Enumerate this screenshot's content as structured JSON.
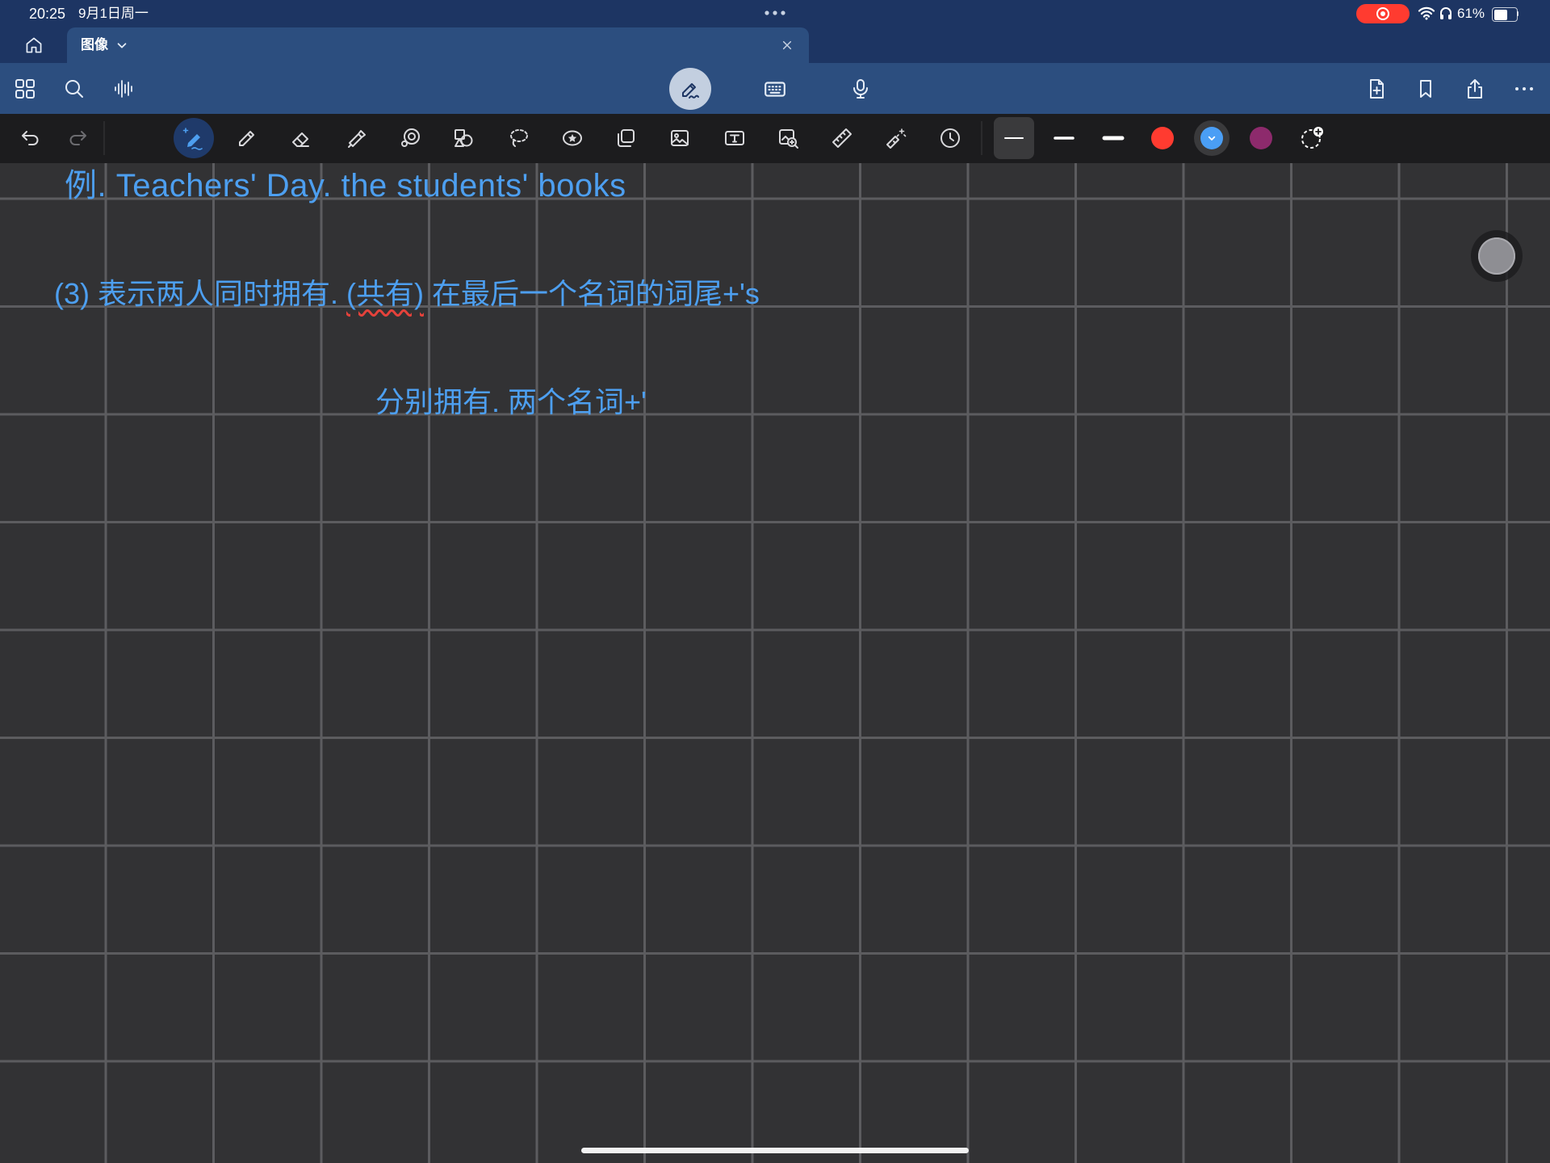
{
  "status_bar": {
    "time": "20:25",
    "date": "9月1日周一",
    "battery_text": "61%",
    "battery_level": 0.61,
    "recording_color": "#ff3b30",
    "icons": [
      "multitasking-dots-icon",
      "screen-recording-icon",
      "wifi-icon",
      "headphones-icon",
      "battery-icon"
    ]
  },
  "tab_strip": {
    "home_icon": "home-icon",
    "active_tab": {
      "title": "图像",
      "dropdown_icon": "chevron-down-icon",
      "close_icon": "close-icon"
    }
  },
  "top_toolbar": {
    "background": "#2c4e7f",
    "left_icons": [
      "grid-icon",
      "search-icon",
      "audio-wave-icon"
    ],
    "center_icons": [
      {
        "icon": "handwriting-mode-icon",
        "selected": true
      },
      {
        "icon": "keyboard-icon",
        "selected": false
      },
      {
        "icon": "microphone-icon",
        "selected": false
      }
    ],
    "right_icons": [
      "add-page-icon",
      "bookmark-icon",
      "share-icon",
      "more-icon"
    ]
  },
  "tool_bar": {
    "history": [
      {
        "icon": "undo-icon",
        "enabled": true
      },
      {
        "icon": "redo-icon",
        "enabled": false
      }
    ],
    "tools": [
      {
        "icon": "pen-icon",
        "selected": true
      },
      {
        "icon": "pencil-icon",
        "selected": false
      },
      {
        "icon": "eraser-icon",
        "selected": false
      },
      {
        "icon": "highlighter-icon",
        "selected": false
      },
      {
        "icon": "shape-recognition-icon",
        "selected": false
      },
      {
        "icon": "shapes-icon",
        "selected": false
      },
      {
        "icon": "lasso-icon",
        "selected": false
      },
      {
        "icon": "sticker-icon",
        "selected": false
      },
      {
        "icon": "elements-icon",
        "selected": false
      },
      {
        "icon": "image-icon",
        "selected": false
      },
      {
        "icon": "text-box-icon",
        "selected": false
      },
      {
        "icon": "camera-scan-icon",
        "selected": false
      },
      {
        "icon": "ruler-icon",
        "selected": false
      },
      {
        "icon": "laser-pointer-icon",
        "selected": false
      },
      {
        "icon": "history-clock-icon",
        "selected": false
      }
    ],
    "stroke_widths": [
      {
        "icon": "thin-stroke-icon",
        "selected": true
      },
      {
        "icon": "medium-stroke-icon",
        "selected": false
      },
      {
        "icon": "thick-stroke-icon",
        "selected": false
      }
    ],
    "colors": [
      {
        "color": "#ff3b30",
        "selected": false
      },
      {
        "color": "#4a9ef5",
        "selected": true
      },
      {
        "color": "#8d2a6c",
        "selected": false
      }
    ],
    "add_color_icon": "add-color-icon"
  },
  "canvas": {
    "background": "#323234",
    "grid_color": "#5c5c5f",
    "ink_color": "#4d9ff0",
    "underline_color": "#e5423b",
    "lines": {
      "line1": "例. Teachers' Day. the students' books",
      "line2_before": "(3) 表示两人同时拥有. ",
      "line2_underlined": "(共有)",
      "line2_after": " 在最后一个名词的词尾+'s",
      "line3": "分别拥有. 两个名词+'"
    }
  },
  "floating_button_icon": "assistive-touch-icon"
}
